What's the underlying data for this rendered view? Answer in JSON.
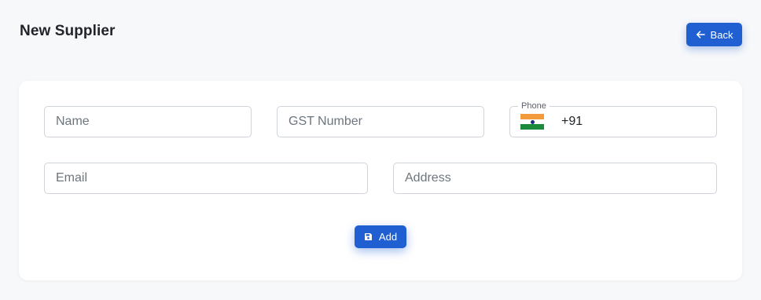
{
  "header": {
    "title": "New Supplier",
    "back_label": "Back",
    "back_icon": "arrow-left-icon"
  },
  "form": {
    "name": {
      "placeholder": "Name",
      "value": ""
    },
    "gst": {
      "placeholder": "GST Number",
      "value": ""
    },
    "phone": {
      "label": "Phone",
      "value": "+91",
      "country_flag": "india-flag-icon"
    },
    "email": {
      "placeholder": "Email",
      "value": ""
    },
    "address": {
      "placeholder": "Address",
      "value": ""
    },
    "add_label": "Add",
    "add_icon": "save-icon"
  },
  "colors": {
    "primary": "#1f5fd1",
    "background": "#f7f8fa",
    "card": "#ffffff",
    "border": "#ced4da"
  }
}
